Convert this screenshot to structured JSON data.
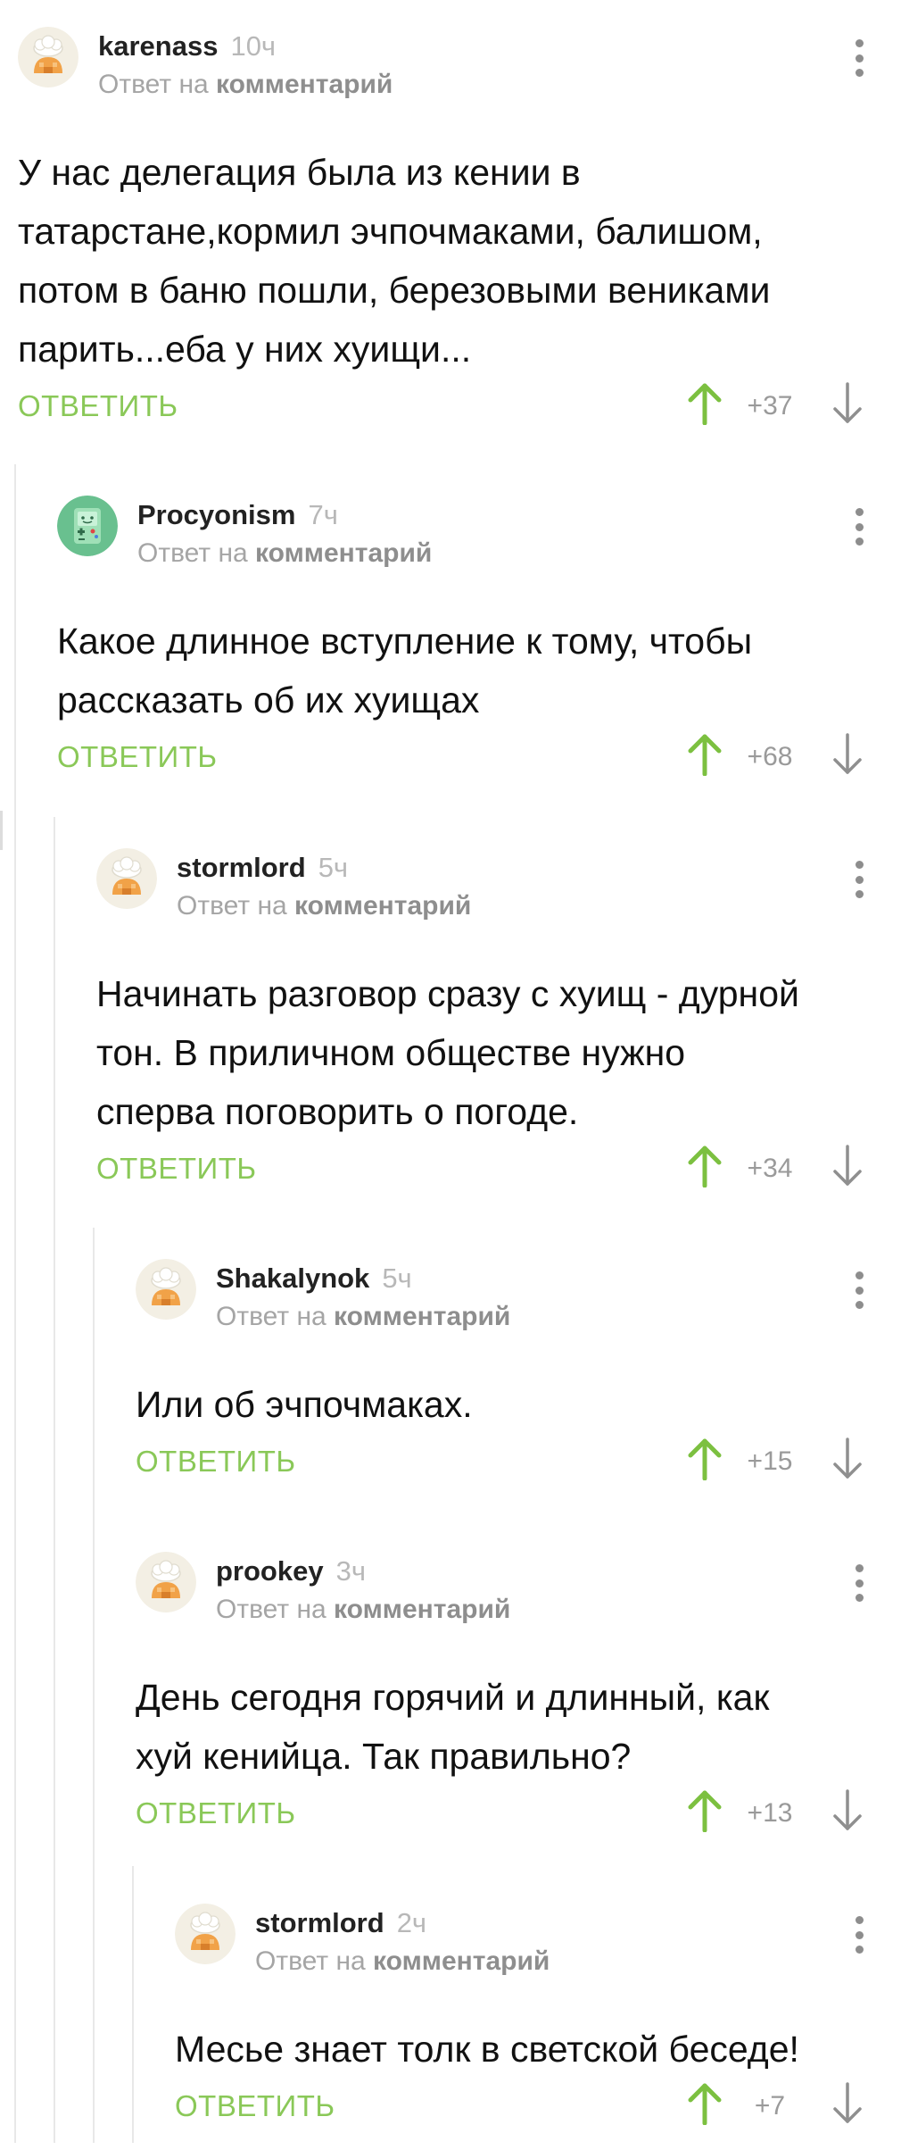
{
  "reply_to_prefix": "Ответ на",
  "reply_to_target": "комментарий",
  "reply_label": "ОТВЕТИТЬ",
  "colors": {
    "accent_green": "#8ac858",
    "muted_gray": "#a5a5a5",
    "thread_line": "#e8e8e8"
  },
  "icons": {
    "avatar_default": "chef-hat-avatar-icon",
    "avatar_custom": "bmo-robot-avatar-icon",
    "menu": "more-vertical-icon",
    "upvote": "arrow-up-icon",
    "downvote": "arrow-down-icon"
  },
  "comments": [
    {
      "author": "karenass",
      "time": "10ч",
      "avatar": "chef-hat-avatar-icon",
      "depth": 0,
      "lines": [
        "У нас делегация была из кении в",
        "татарстане,кормил эчпочмаками, балишом,",
        "потом в баню пошли, березовыми вениками",
        "парить...еба у них хуищи..."
      ],
      "rating": "+37"
    },
    {
      "author": "Procyonism",
      "time": "7ч",
      "avatar": "bmo-robot-avatar-icon",
      "depth": 1,
      "lines": [
        "Какое длинное вступление к тому, чтобы",
        "рассказать об их хуищах"
      ],
      "rating": "+68"
    },
    {
      "author": "stormlord",
      "time": "5ч",
      "avatar": "chef-hat-avatar-icon",
      "depth": 2,
      "lines": [
        "Начинать разговор сразу с хуищ - дурной",
        "тон. В приличном обществе нужно",
        "сперва поговорить о погоде."
      ],
      "rating": "+34"
    },
    {
      "author": "Shakalynok",
      "time": "5ч",
      "avatar": "chef-hat-avatar-icon",
      "depth": 3,
      "lines": [
        "Или об эчпочмаках."
      ],
      "rating": "+15"
    },
    {
      "author": "prookey",
      "time": "3ч",
      "avatar": "chef-hat-avatar-icon",
      "depth": 3,
      "lines": [
        "День сегодня горячий и длинный, как",
        "хуй кенийца. Так правильно?"
      ],
      "rating": "+13"
    },
    {
      "author": "stormlord",
      "time": "2ч",
      "avatar": "chef-hat-avatar-icon",
      "depth": 4,
      "lines": [
        "Месье знает толк в светской беседе!"
      ],
      "rating": "+7"
    }
  ]
}
